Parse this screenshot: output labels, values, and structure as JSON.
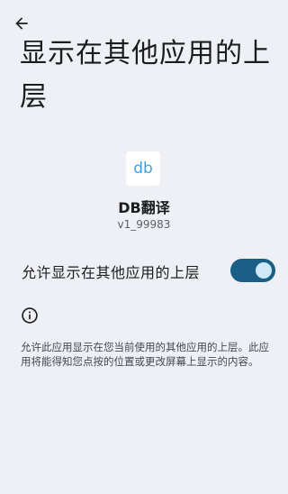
{
  "header": {
    "back_icon": "arrow-back-icon"
  },
  "page_title": "显示在其他应用的上层",
  "app": {
    "icon_text": "db",
    "name": "DB翻译",
    "version": "v1_99983",
    "icon_color": "#3aa2e9"
  },
  "setting": {
    "label": "允许显示在其他应用的上层",
    "enabled": true,
    "accent_color": "#1a5f85"
  },
  "info": {
    "icon": "info-icon",
    "description": "允许此应用显示在您当前使用的其他应用的上层。此应用将能得知您点按的位置或更改屏幕上显示的内容。"
  }
}
